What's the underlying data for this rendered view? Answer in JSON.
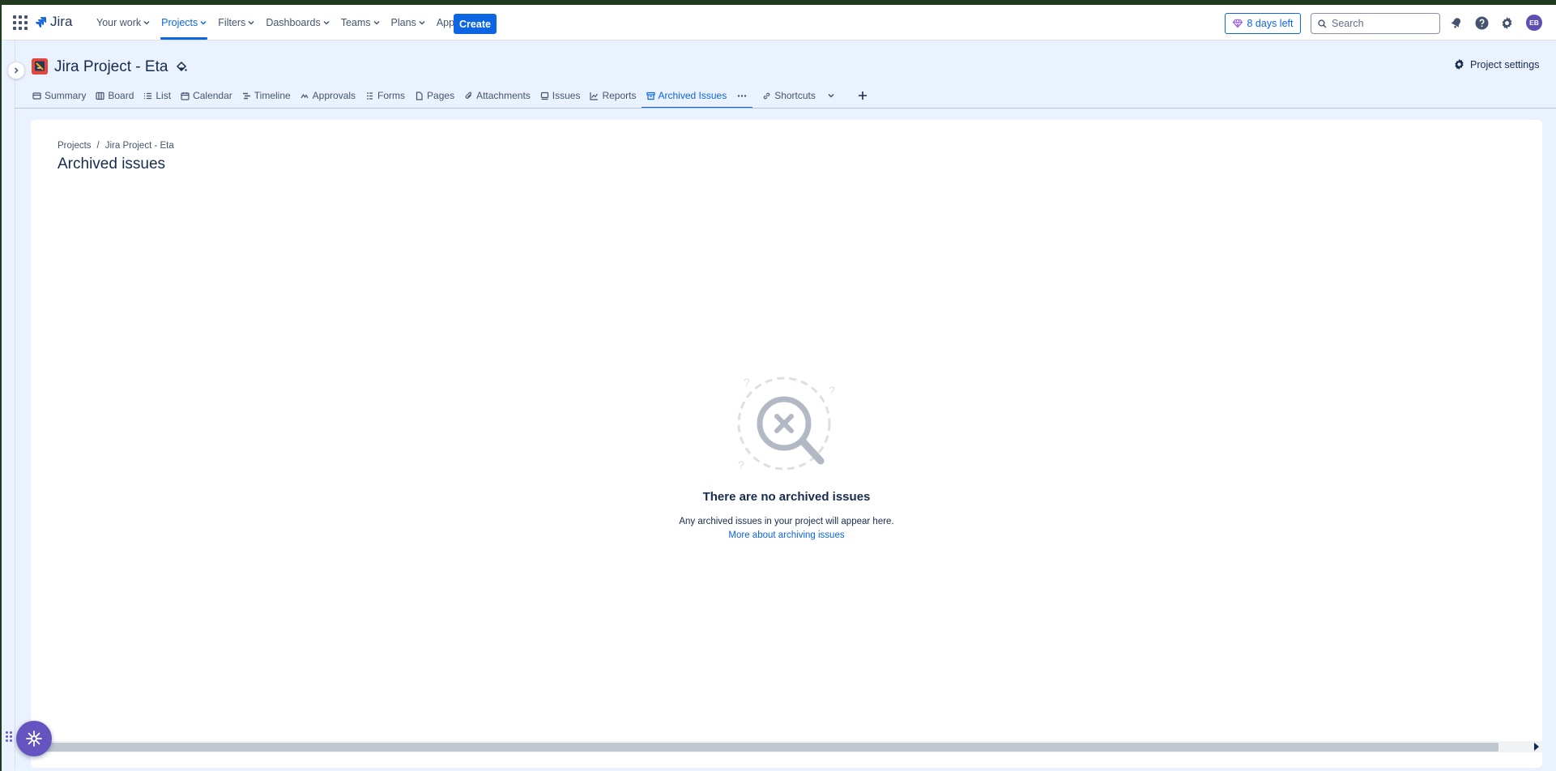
{
  "topnav": {
    "app_name": "Jira",
    "menu": [
      {
        "label": "Your work",
        "active": false
      },
      {
        "label": "Projects",
        "active": true
      },
      {
        "label": "Filters",
        "active": false
      },
      {
        "label": "Dashboards",
        "active": false
      },
      {
        "label": "Teams",
        "active": false
      },
      {
        "label": "Plans",
        "active": false
      },
      {
        "label": "Apps",
        "active": false
      }
    ],
    "create_label": "Create",
    "trial_label": "8 days left",
    "search_placeholder": "Search",
    "avatar_initials": "EB",
    "icons": [
      "app-switcher-icon",
      "notifications-icon",
      "help-icon",
      "settings-icon"
    ]
  },
  "project": {
    "title": "Jira Project - Eta",
    "settings_label": "Project settings",
    "tabs": [
      {
        "label": "Summary",
        "icon": "summary-icon",
        "active": false
      },
      {
        "label": "Board",
        "icon": "board-icon",
        "active": false
      },
      {
        "label": "List",
        "icon": "list-icon",
        "active": false
      },
      {
        "label": "Calendar",
        "icon": "calendar-icon",
        "active": false
      },
      {
        "label": "Timeline",
        "icon": "timeline-icon",
        "active": false
      },
      {
        "label": "Approvals",
        "icon": "approvals-icon",
        "active": false
      },
      {
        "label": "Forms",
        "icon": "forms-icon",
        "active": false
      },
      {
        "label": "Pages",
        "icon": "pages-icon",
        "active": false
      },
      {
        "label": "Attachments",
        "icon": "attachment-icon",
        "active": false
      },
      {
        "label": "Issues",
        "icon": "issues-icon",
        "active": false
      },
      {
        "label": "Reports",
        "icon": "reports-icon",
        "active": false
      },
      {
        "label": "Archived Issues",
        "icon": "archive-icon",
        "active": true
      },
      {
        "label": "Shortcuts",
        "icon": "link-icon",
        "active": false
      }
    ]
  },
  "page": {
    "breadcrumb": [
      "Projects",
      "Jira Project - Eta"
    ],
    "breadcrumb_separator": "/",
    "title": "Archived issues",
    "empty_state": {
      "title": "There are no archived issues",
      "description": "Any archived issues in your project will appear here.",
      "link": "More about archiving issues"
    }
  },
  "colors": {
    "accent": "#0c66e4",
    "header_bg": "#e9f2fe",
    "fab": "#6554c0",
    "project_avatar": "#e2483d"
  }
}
